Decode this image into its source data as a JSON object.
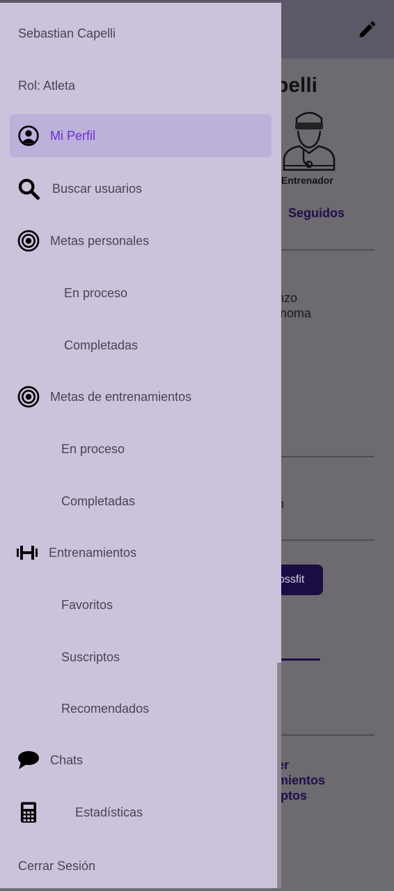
{
  "background": {
    "profile_name_fragment": "pelli",
    "coach_label": "Entrenador",
    "followed_tab": "Seguidos",
    "fragment_1": "nzo",
    "fragment_2": "noma",
    "fragment_3": "n",
    "chip_label": "ossfit",
    "link_line_1": "er",
    "link_line_2": "mientos",
    "link_line_3": "iptos"
  },
  "drawer": {
    "user_name": "Sebastian Capelli",
    "role": "Rol: Atleta",
    "items": [
      {
        "label": "Mi Perfil",
        "icon": "account-circle-icon",
        "active": true
      },
      {
        "label": "Buscar usuarios",
        "icon": "search-icon"
      },
      {
        "label": "Metas personales",
        "icon": "target-icon",
        "subitems": [
          "En proceso",
          "Completadas"
        ]
      },
      {
        "label": "Metas de entrenamientos",
        "icon": "target-icon",
        "subitems": [
          "En proceso",
          "Completadas"
        ]
      },
      {
        "label": "Entrenamientos",
        "icon": "dumbbell-icon",
        "subitems": [
          "Favoritos",
          "Suscriptos",
          "Recomendados"
        ]
      },
      {
        "label": "Chats",
        "icon": "chat-bubble-icon"
      },
      {
        "label": "Estadísticas",
        "icon": "calculator-icon"
      }
    ],
    "logout_label": "Cerrar Sesión"
  },
  "colors": {
    "drawer_bg": "#ccc2dc",
    "active_bg": "#bdb0da",
    "active_text": "#6a2fd4",
    "scrim": "#6d6a70"
  }
}
